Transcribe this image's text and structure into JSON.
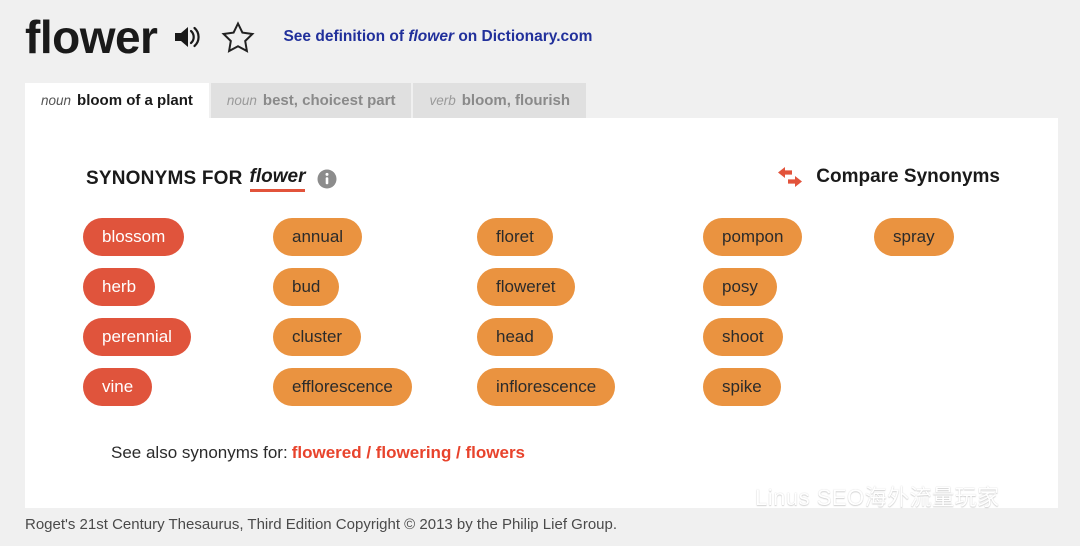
{
  "header": {
    "word": "flower",
    "speaker_icon": "speaker-icon",
    "star_icon": "star-outline-icon",
    "definition_link_prefix": "See definition of",
    "definition_link_word": "flower",
    "definition_link_suffix": "on Dictionary.com",
    "link_color": "#21309b"
  },
  "tabs": [
    {
      "pos": "noun",
      "label": "bloom of a plant",
      "active": true
    },
    {
      "pos": "noun",
      "label": "best, choicest part",
      "active": false
    },
    {
      "pos": "verb",
      "label": "bloom, flourish",
      "active": false
    }
  ],
  "synonyms_header": {
    "title": "SYNONYMS FOR",
    "word": "flower",
    "info_icon": "info-icon",
    "underline_color": "#e2533b"
  },
  "compare": {
    "icon": "compare-arrows-icon",
    "label": "Compare Synonyms",
    "icon_color": "#e2533b"
  },
  "chip_colors": {
    "strong_bg": "#e0543c",
    "strong_text": "#ffffff",
    "weak_bg": "#ea9340",
    "weak_text": "#2b2b2b"
  },
  "synonym_columns": [
    {
      "strength": "strong",
      "chips": [
        "blossom",
        "herb",
        "perennial",
        "vine"
      ]
    },
    {
      "strength": "weak",
      "chips": [
        "annual",
        "bud",
        "cluster",
        "efflorescence"
      ]
    },
    {
      "strength": "weak",
      "chips": [
        "floret",
        "floweret",
        "head",
        "inflorescence"
      ]
    },
    {
      "strength": "weak",
      "chips": [
        "pompon",
        "posy",
        "shoot",
        "spike"
      ]
    },
    {
      "strength": "weak",
      "chips": [
        "spray"
      ]
    }
  ],
  "see_also": {
    "label": "See also synonyms for:",
    "links": "flowered / flowering / flowers",
    "link_color": "#e8432c"
  },
  "watermark": {
    "icon": "wechat-icon",
    "text": "Linus SEO海外流量玩家"
  },
  "footer": {
    "copyright": "Roget's 21st Century Thesaurus, Third Edition Copyright © 2013 by the Philip Lief Group."
  }
}
